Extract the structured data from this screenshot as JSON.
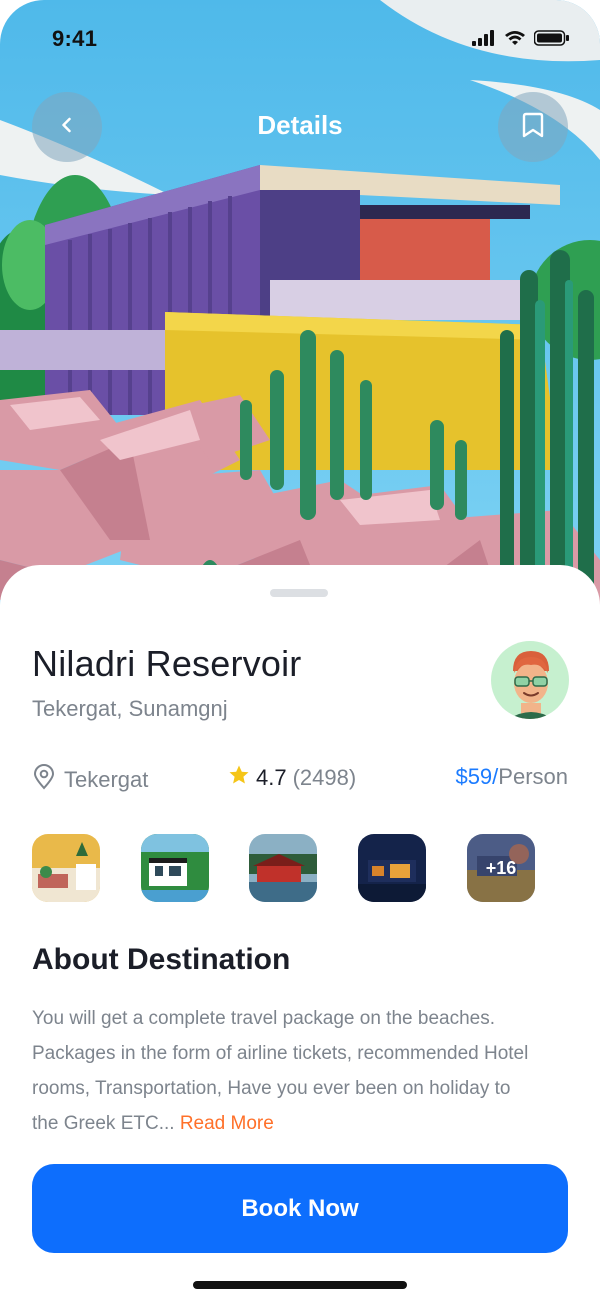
{
  "status_bar": {
    "time": "9:41",
    "icons": [
      "signal-icon",
      "wifi-icon",
      "battery-icon"
    ]
  },
  "header": {
    "title": "Details",
    "back_icon": "chevron-left-icon",
    "bookmark_icon": "bookmark-icon"
  },
  "destination": {
    "name": "Niladri Reservoir",
    "subtitle": "Tekergat, Sunamgnj",
    "location": "Tekergat",
    "rating": "4.7",
    "review_count": "(2498)",
    "price": "$59/",
    "price_unit": "Person"
  },
  "gallery": {
    "more_label": "+16"
  },
  "about": {
    "title": "About Destination",
    "text": "You will get a complete travel package on the beaches. Packages in the form of airline tickets, recommended Hotel rooms, Transportation, Have you ever been on holiday to the Greek ETC...",
    "read_more": "Read More"
  },
  "cta": {
    "label": "Book Now"
  },
  "colors": {
    "accent": "#0d6efd",
    "price": "#1b7bff",
    "read_more": "#ff7029",
    "star": "#f5c518",
    "avatar_bg": "#c6f0cf"
  }
}
